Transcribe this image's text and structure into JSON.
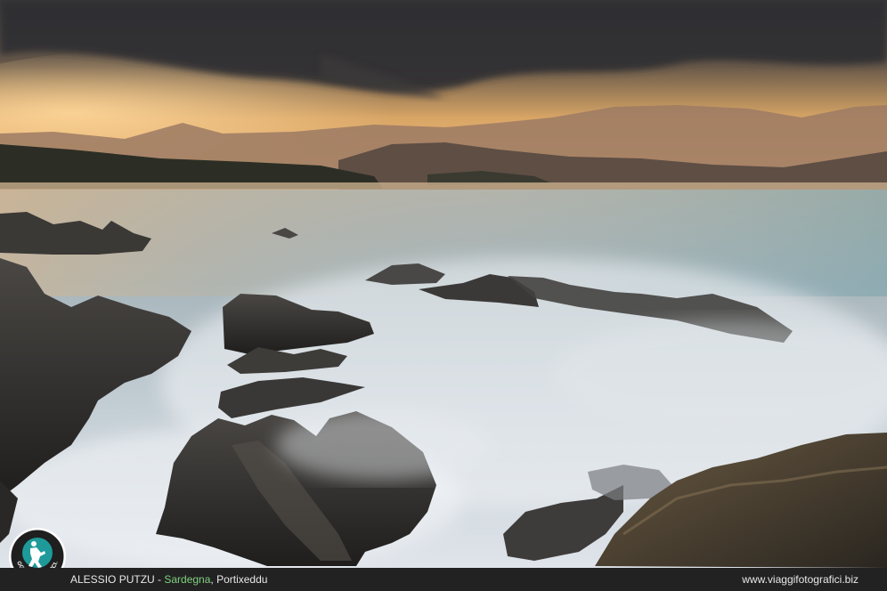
{
  "caption": {
    "author": "ALESSIO PUTZU",
    "separator": " - ",
    "region": "Sardegna",
    "place": ", Portixeddu",
    "website": "www.viaggifotografici.biz"
  },
  "logo": {
    "text": "VIAGGIFOTOGRAFICI.BIZ",
    "icon": "photographer-icon"
  },
  "colors": {
    "region_accent": "#7fd17f",
    "logo_teal": "#1f9a9a",
    "bar_background": "#222222"
  }
}
